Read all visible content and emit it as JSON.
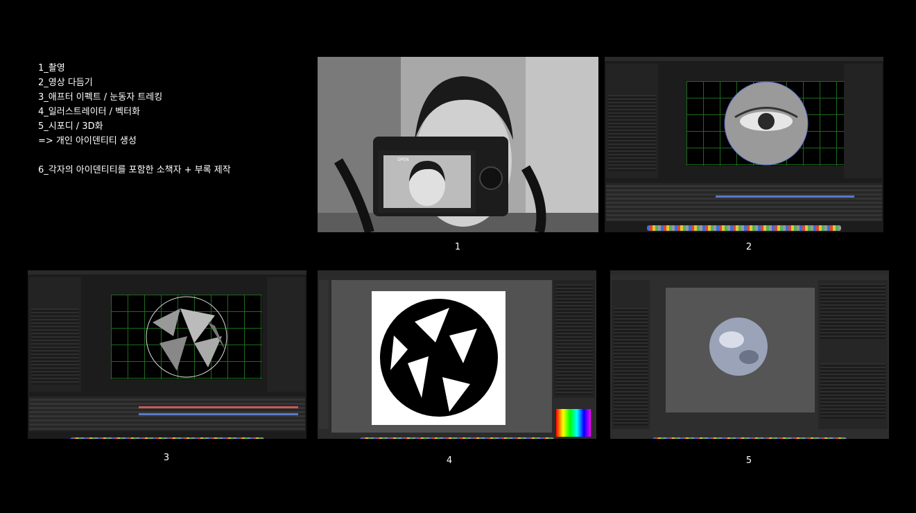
{
  "steps": [
    "1_촬영",
    "2_영상 다듬기",
    "3_애프터 이펙트 / 눈동자 트레킹",
    "4_일러스트레이터 / 벡터화",
    "5_시포디 / 3D화",
    "=> 개인 아이덴티티 생성",
    "6_각자의 아이덴티티를 포함한 소책자 + 부록 제작"
  ],
  "captions": [
    "1",
    "2",
    "3",
    "4",
    "5"
  ],
  "screens": {
    "photo": {
      "camera_label": "OPEN"
    },
    "after_effects": {
      "app_name": "After Effects"
    },
    "illustrator": {
      "app_name": "Illustrator"
    },
    "cinema4d": {
      "app_name": "Cinema 4D"
    }
  },
  "colors": {
    "background": "#000000",
    "text": "#ffffff",
    "grid": "#1d6b1d"
  }
}
